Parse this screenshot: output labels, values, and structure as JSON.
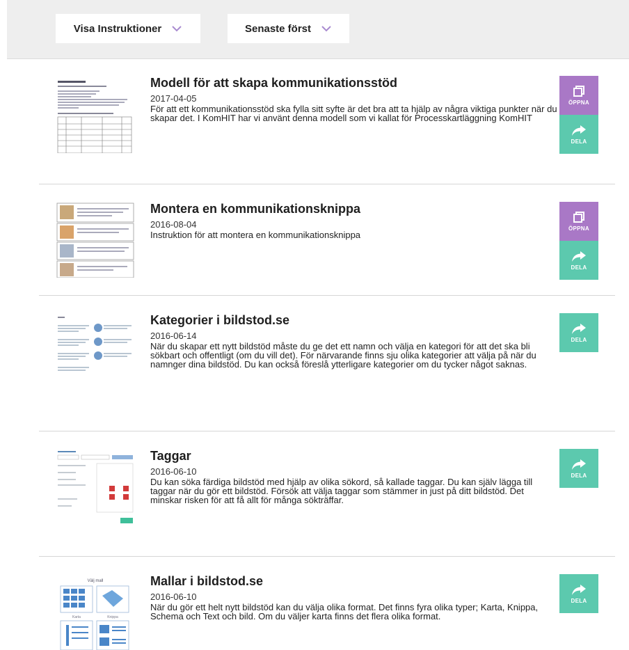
{
  "toolbar": {
    "instructions_label": "Visa Instruktioner",
    "sort_label": "Senaste först"
  },
  "actions": {
    "open_label": "ÖPPNA",
    "share_label": "DELA"
  },
  "colors": {
    "open": "#a978c6",
    "share": "#5cc9ae",
    "toolbar_bg": "#eeeeee"
  },
  "items": [
    {
      "title": "Modell för att skapa kommunikationsstöd",
      "date": "2017-04-05",
      "description": "För att ett kommunikationsstöd ska fylla sitt syfte är det bra att ta hjälp av några viktiga punkter när du skapar det. I KomHIT har vi använt denna modell som vi kallat för Processkartläggning KomHIT",
      "has_open": true
    },
    {
      "title": "Montera en kommunikationsknippa",
      "date": "2016-08-04",
      "description": "Instruktion för att montera en kommunikationsknippa",
      "has_open": true
    },
    {
      "title": "Kategorier i bildstod.se",
      "date": "2016-06-14",
      "description": "När du skapar ett nytt bildstöd måste du ge det ett namn och välja en kategori för att det ska bli sökbart och offentligt (om du vill det). För närvarande finns sju olika kategorier att välja på när du namnger dina bildstöd. Du kan också föreslå ytterligare kategorier om du tycker något saknas.",
      "has_open": false
    },
    {
      "title": "Taggar",
      "date": "2016-06-10",
      "description": "Du kan söka färdiga bildstöd med hjälp av olika sökord, så kallade taggar. Du kan själv lägga till taggar när du gör ett bildstöd. Försök att välja taggar som stämmer in just på ditt bildstöd. Det minskar risken för att få allt för många sökträffar.",
      "has_open": false
    },
    {
      "title": "Mallar i bildstod.se",
      "date": "2016-06-10",
      "description": "När du gör ett helt nytt bildstöd kan du välja olika format. Det finns fyra olika typer; Karta, Knippa, Schema och Text och bild. Om du väljer karta finns det flera olika format.",
      "has_open": false,
      "thumb_labels": [
        "Välj mall",
        "Karta",
        "Knippa"
      ]
    }
  ]
}
